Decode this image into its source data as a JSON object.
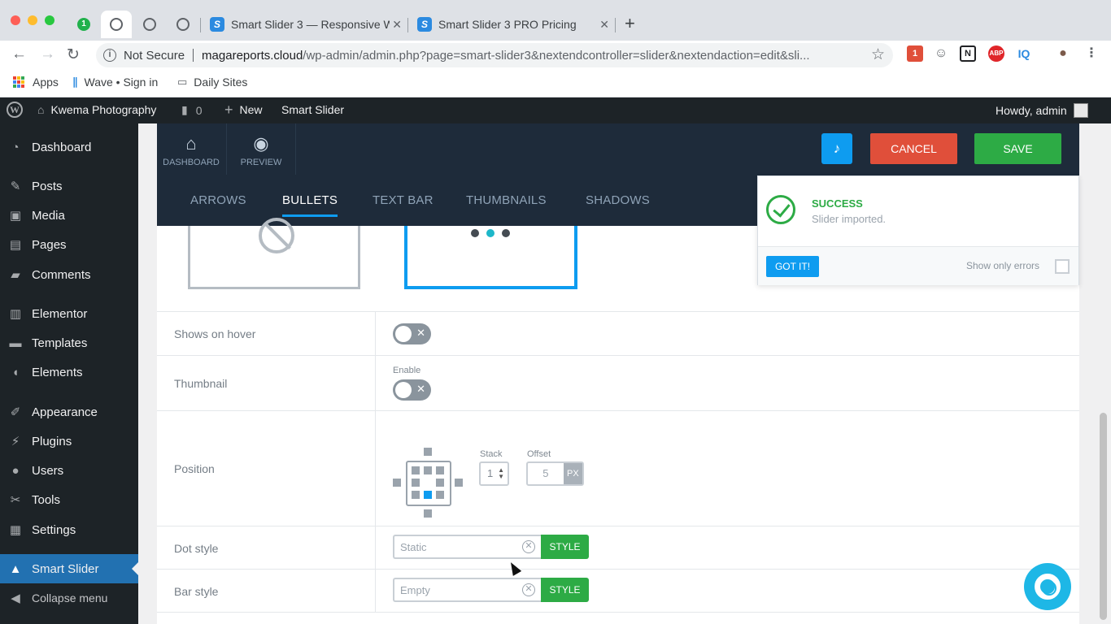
{
  "browser": {
    "pinned_badge": "1",
    "tabs": [
      {
        "title": "Smart Slider 3 — Responsive W",
        "favicon": "S"
      },
      {
        "title": "Smart Slider 3 PRO Pricing",
        "favicon": "S"
      }
    ],
    "security": "Not Secure",
    "url_host": "magareports.cloud",
    "url_path": "/wp-admin/admin.php?page=smart-slider3&nextendcontroller=slider&nextendaction=edit&sli...",
    "extensions": [
      "1",
      "N",
      "ABP",
      "IQ"
    ],
    "bookmarks": [
      "Apps",
      "Wave • Sign in",
      "Daily Sites"
    ]
  },
  "adminbar": {
    "site": "Kwema Photography",
    "comments": "0",
    "new": "New",
    "plugin": "Smart Slider",
    "howdy": "Howdy, admin"
  },
  "sidebar": {
    "items": [
      {
        "label": "Dashboard",
        "icon": "dashboard-icon"
      },
      {
        "label": "Posts",
        "icon": "pin-icon"
      },
      {
        "label": "Media",
        "icon": "media-icon"
      },
      {
        "label": "Pages",
        "icon": "pages-icon"
      },
      {
        "label": "Comments",
        "icon": "comment-icon"
      },
      {
        "label": "Elementor",
        "icon": "elementor-icon"
      },
      {
        "label": "Templates",
        "icon": "folder-icon"
      },
      {
        "label": "Elements",
        "icon": "elements-icon"
      },
      {
        "label": "Appearance",
        "icon": "brush-icon"
      },
      {
        "label": "Plugins",
        "icon": "plug-icon"
      },
      {
        "label": "Users",
        "icon": "user-icon"
      },
      {
        "label": "Tools",
        "icon": "wrench-icon"
      },
      {
        "label": "Settings",
        "icon": "settings-icon"
      },
      {
        "label": "Smart Slider",
        "icon": "graduation-icon"
      },
      {
        "label": "Collapse menu",
        "icon": "collapse-icon"
      }
    ]
  },
  "slider": {
    "dashboard": "DASHBOARD",
    "preview": "PREVIEW",
    "cancel": "CANCEL",
    "save": "SAVE",
    "tabs": [
      "ARROWS",
      "BULLETS",
      "TEXT BAR",
      "THUMBNAILS",
      "SHADOWS"
    ],
    "active_tab": "BULLETS",
    "rows": {
      "shows_on_hover": "Shows on hover",
      "thumbnail": "Thumbnail",
      "enable": "Enable",
      "position": "Position",
      "stack_label": "Stack",
      "stack_value": "1",
      "offset_label": "Offset",
      "offset_value": "5",
      "offset_unit": "PX",
      "dot_style": "Dot style",
      "dot_style_value": "Static",
      "bar_style": "Bar style",
      "bar_style_value": "Empty",
      "style_btn": "STYLE"
    }
  },
  "notice": {
    "title": "SUCCESS",
    "message": "Slider imported.",
    "gotit": "GOT IT!",
    "only_errors": "Show only errors"
  },
  "colors": {
    "accent": "#0e9cf0",
    "save": "#2dab45",
    "cancel": "#e04f3a",
    "wp_dark": "#1d2327",
    "header": "#1e2b3a"
  }
}
